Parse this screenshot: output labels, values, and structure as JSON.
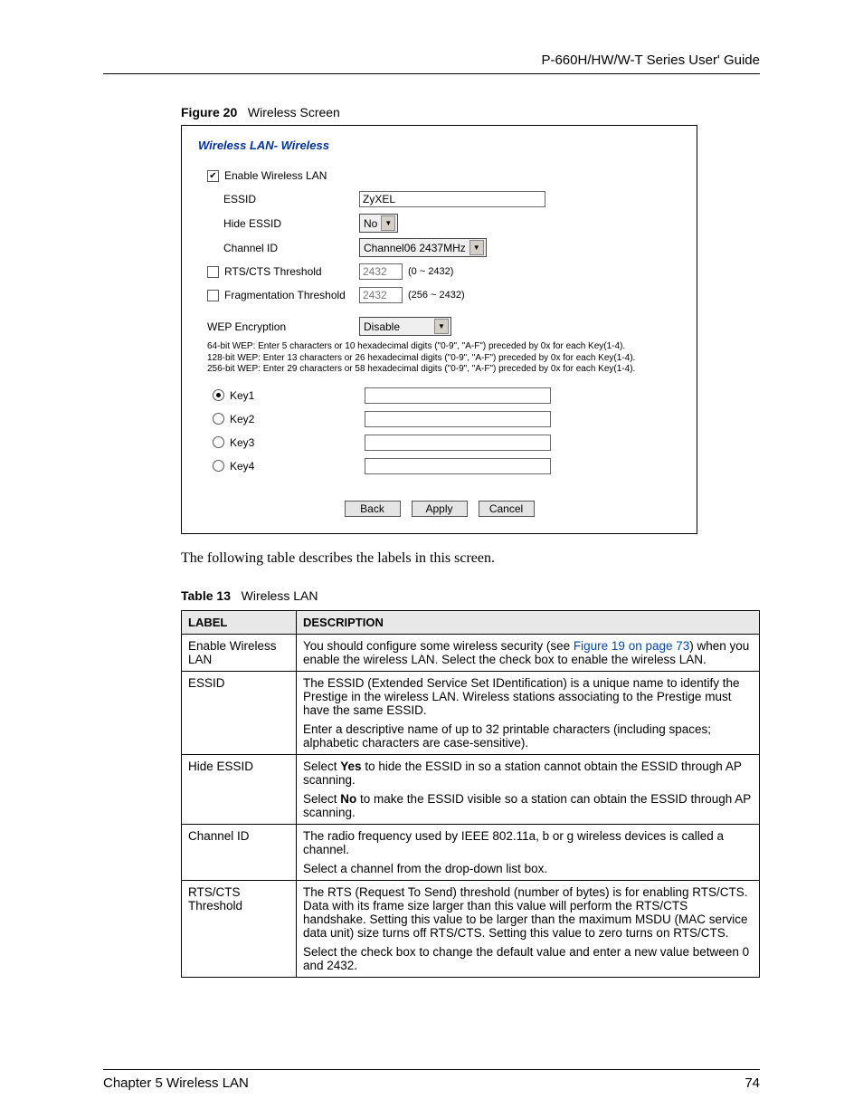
{
  "header": {
    "title": "P-660H/HW/W-T Series User' Guide"
  },
  "figure": {
    "label": "Figure 20",
    "title": "Wireless Screen"
  },
  "screenshot": {
    "breadcrumb": "Wireless LAN- Wireless",
    "enable_lan": {
      "label": "Enable Wireless LAN",
      "checked": true
    },
    "essid": {
      "label": "ESSID",
      "value": "ZyXEL"
    },
    "hide_essid": {
      "label": "Hide ESSID",
      "value": "No"
    },
    "channel_id": {
      "label": "Channel ID",
      "value": "Channel06 2437MHz"
    },
    "rts": {
      "label": "RTS/CTS Threshold",
      "checked": false,
      "value": "2432",
      "range": "(0 ~ 2432)"
    },
    "frag": {
      "label": "Fragmentation Threshold",
      "checked": false,
      "value": "2432",
      "range": "(256 ~ 2432)"
    },
    "wep": {
      "label": "WEP Encryption",
      "value": "Disable"
    },
    "note_line1": "64-bit WEP: Enter 5 characters or 10 hexadecimal digits (\"0-9\", \"A-F\") preceded by 0x for each Key(1-4).",
    "note_line2": "128-bit WEP: Enter 13 characters or 26 hexadecimal digits (\"0-9\", \"A-F\") preceded by 0x for each Key(1-4).",
    "note_line3": "256-bit WEP: Enter 29 characters or 58 hexadecimal digits (\"0-9\", \"A-F\") preceded by 0x for each Key(1-4).",
    "keys": [
      {
        "label": "Key1",
        "selected": true
      },
      {
        "label": "Key2",
        "selected": false
      },
      {
        "label": "Key3",
        "selected": false
      },
      {
        "label": "Key4",
        "selected": false
      }
    ],
    "buttons": {
      "back": "Back",
      "apply": "Apply",
      "cancel": "Cancel"
    }
  },
  "intro_para": "The following table describes the labels in this screen.",
  "table": {
    "label": "Table 13",
    "title": "Wireless LAN",
    "head_label": "LABEL",
    "head_desc": "DESCRIPTION",
    "rows": [
      {
        "label": "Enable Wireless LAN",
        "desc": [
          {
            "type": "link",
            "pre": "You should configure some wireless security (see ",
            "link": "Figure 19 on page 73",
            "post": ") when you enable the wireless LAN. Select the check box to enable the wireless LAN."
          }
        ]
      },
      {
        "label": "ESSID",
        "desc": [
          {
            "type": "plain",
            "text": "The ESSID (Extended Service Set IDentification) is a unique name to identify the Prestige in the wireless LAN. Wireless stations associating to the Prestige must have the same ESSID."
          },
          {
            "type": "plain",
            "text": "Enter a descriptive name of up to 32 printable characters (including spaces; alphabetic characters are case-sensitive)."
          }
        ]
      },
      {
        "label": "Hide ESSID",
        "desc": [
          {
            "type": "bold",
            "pre": "Select ",
            "bold": "Yes",
            "post": " to hide the ESSID in so a station cannot obtain the ESSID through AP scanning."
          },
          {
            "type": "bold",
            "pre": "Select ",
            "bold": "No",
            "post": " to make the ESSID visible so a station can obtain the ESSID through AP scanning."
          }
        ]
      },
      {
        "label": "Channel ID",
        "desc": [
          {
            "type": "plain",
            "text": "The radio frequency used by IEEE 802.11a, b or g wireless devices is called a channel."
          },
          {
            "type": "plain",
            "text": "Select a channel from the drop-down list box."
          }
        ]
      },
      {
        "label": "RTS/CTS Threshold",
        "desc": [
          {
            "type": "plain",
            "text": "The RTS (Request To Send) threshold (number of bytes) is for enabling RTS/CTS. Data with its frame size larger than this value will perform the RTS/CTS handshake. Setting this value to be larger than the maximum MSDU (MAC service data unit) size turns off RTS/CTS. Setting this value to zero turns on RTS/CTS."
          },
          {
            "type": "plain",
            "text": "Select the check box to change the default value and enter a new value between 0 and 2432."
          }
        ]
      }
    ]
  },
  "footer": {
    "chapter": "Chapter 5 Wireless LAN",
    "page": "74"
  }
}
